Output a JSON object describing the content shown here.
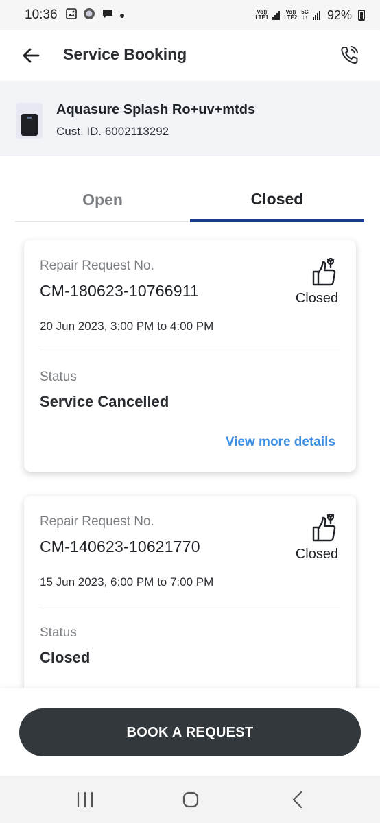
{
  "status_bar": {
    "time": "10:36",
    "sim1": "LTE1",
    "sim2": "LTE2",
    "network": "5G",
    "battery": "92%"
  },
  "header": {
    "title": "Service Booking",
    "back_icon": "arrow-left-icon",
    "call_icon": "phone-call-icon"
  },
  "product": {
    "name": "Aquasure Splash Ro+uv+mtds",
    "customer_id": "Cust. ID. 6002113292"
  },
  "tabs": [
    {
      "label": "Open",
      "active": false
    },
    {
      "label": "Closed",
      "active": true
    }
  ],
  "requests": [
    {
      "label": "Repair Request No.",
      "number": "CM-180623-10766911",
      "date": "20 Jun 2023, 3:00 PM to 4:00 PM",
      "badge": "Closed",
      "status_label": "Status",
      "status": "Service Cancelled",
      "link": "View more details"
    },
    {
      "label": "Repair Request No.",
      "number": "CM-140623-10621770",
      "date": "15 Jun 2023, 6:00 PM to 7:00 PM",
      "badge": "Closed",
      "status_label": "Status",
      "status": "Closed"
    }
  ],
  "actions": {
    "book_label": "BOOK A REQUEST"
  },
  "colors": {
    "accent": "#1b3a8e",
    "link": "#3d8fe3",
    "button": "#33383c"
  }
}
